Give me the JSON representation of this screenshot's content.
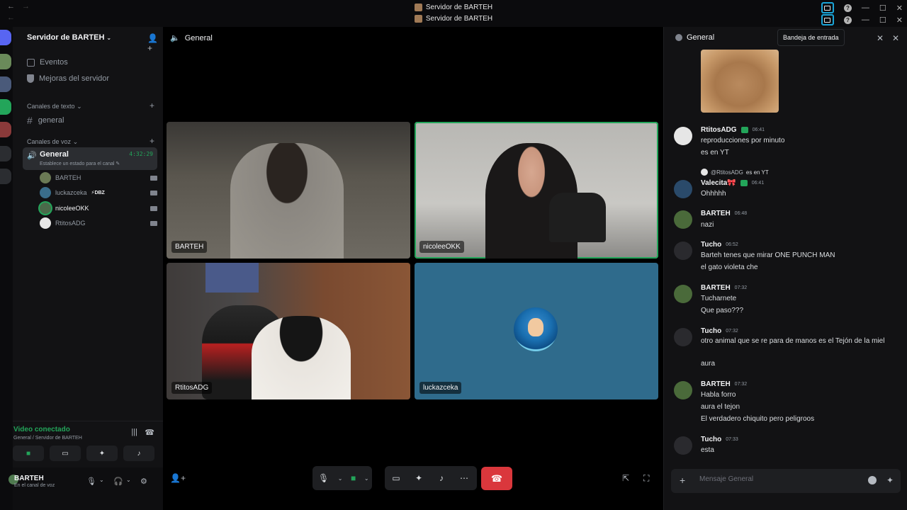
{
  "titlebar": {
    "title_1": "Servidor de BARTEH",
    "title_2": "Servidor de BARTEH"
  },
  "sidebar": {
    "server_name": "Servidor de BARTEH",
    "items": [
      {
        "label": "Eventos"
      },
      {
        "label": "Mejoras del servidor"
      }
    ],
    "text_category": "Canales de texto",
    "text_channel": "general",
    "voice_category": "Canales de voz",
    "voice_channel": {
      "name": "General",
      "duration": "4:32:29",
      "status_hint": "Establece un estado para el canal"
    },
    "voice_users": [
      {
        "name": "BARTEH"
      },
      {
        "name": "luckazceka",
        "tag": "⚡DBZ"
      },
      {
        "name": "nicoleeOKK"
      },
      {
        "name": "RtitosADG"
      }
    ]
  },
  "voice_panel": {
    "title": "Video conectado",
    "subtitle": "General / Servidor de BARTEH"
  },
  "user_panel": {
    "name": "BARTEH",
    "status": "En el canal de voz"
  },
  "stage": {
    "channel_title": "General",
    "tiles": [
      {
        "label": "BARTEH"
      },
      {
        "label": "nicoleeOKK"
      },
      {
        "label": "RtitosADG"
      },
      {
        "label": "luckazceka"
      }
    ]
  },
  "chat": {
    "title": "General",
    "tooltip": "Bandeja de entrada",
    "input_placeholder": "Mensaje General",
    "messages": [
      {
        "author": "RtitosADG",
        "time": "06:41",
        "lines": [
          "reproducciones por minuto",
          "es en YT"
        ]
      },
      {
        "reply_to": "@RtitosADG",
        "reply_text": "es en YT",
        "author": "Valecita🎀",
        "time": "06:41",
        "lines": [
          "Ohhhhh"
        ]
      },
      {
        "author": "BARTEH",
        "time": "06:48",
        "lines": [
          "nazi"
        ]
      },
      {
        "author": "Tucho",
        "time": "06:52",
        "lines": [
          "Barteh tenes que mirar ONE PUNCH MAN",
          "el gato violeta che"
        ]
      },
      {
        "author": "BARTEH",
        "time": "07:32",
        "lines": [
          "Tucharnete",
          "Que paso???"
        ]
      },
      {
        "author": "Tucho",
        "time": "07:32",
        "lines": [
          "otro animal que se re para de manos es el Tejón de la miel",
          "aura"
        ]
      },
      {
        "author": "BARTEH",
        "time": "07:32",
        "lines": [
          "Habla forro",
          "aura el tejon",
          "El verdadero chiquito pero peligroos"
        ]
      },
      {
        "author": "Tucho",
        "time": "07:33",
        "lines": [
          "esta"
        ]
      }
    ]
  },
  "colors": {
    "accent_green": "#23a55a",
    "hangup_red": "#da373c",
    "highlight_blue": "#1aa5d8"
  }
}
